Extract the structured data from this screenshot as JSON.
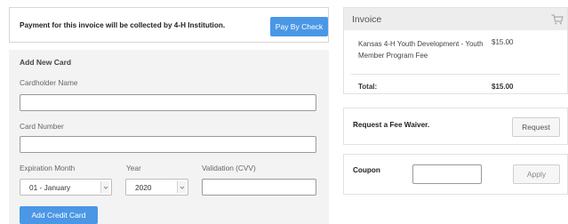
{
  "payment_notice": {
    "message": "Payment for this invoice will be collected by 4-H Institution.",
    "pay_by_check_label": "Pay By Check"
  },
  "card_form": {
    "title": "Add New Card",
    "cardholder_label": "Cardholder Name",
    "cardholder_value": "",
    "card_number_label": "Card Number",
    "card_number_value": "",
    "expiration_month_label": "Expiration Month",
    "expiration_month_selected": "01 - January",
    "year_label": "Year",
    "year_selected": "2020",
    "cvv_label": "Validation (CVV)",
    "cvv_value": "",
    "submit_label": "Add Credit Card"
  },
  "invoice": {
    "title": "Invoice",
    "cart_icon": "shopping-cart-icon",
    "items": [
      {
        "name": "Kansas 4-H Youth Development - Youth Member Program Fee",
        "price": "$15.00"
      }
    ],
    "total_label": "Total:",
    "total_value": "$15.00"
  },
  "fee_waiver": {
    "label": "Request a Fee Waiver.",
    "button_label": "Request"
  },
  "coupon": {
    "label": "Coupon",
    "value": "",
    "button_label": "Apply"
  },
  "colors": {
    "primary_button": "#4a97e6",
    "panel_header": "#ededed",
    "form_background": "#f3f3f3"
  }
}
